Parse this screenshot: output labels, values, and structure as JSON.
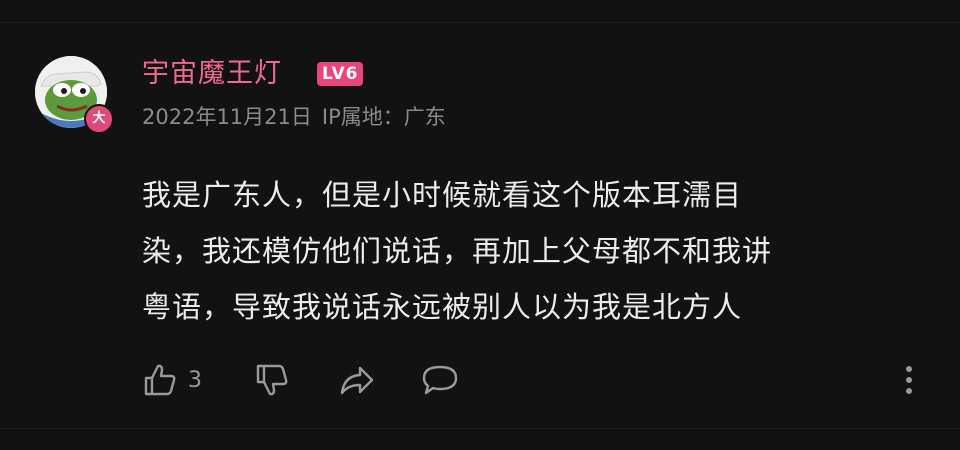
{
  "comment": {
    "username": "宇宙魔王灯",
    "level": "LV6",
    "avatar_badge": "大",
    "date": "2022年11月21日",
    "ip_location": "IP属地：广东",
    "text_lines": [
      "我是广东人，但是小时候就看这个版本耳濡目",
      "染，我还模仿他们说话，再加上父母都不和我讲",
      "粤语，导致我说话永远被别人以为我是北方人"
    ],
    "like_count": "3"
  },
  "icons": {
    "like": "thumbs-up-icon",
    "dislike": "thumbs-down-icon",
    "share": "share-icon",
    "reply": "reply-icon",
    "more": "more-vertical-icon"
  },
  "colors": {
    "background": "#121212",
    "username": "#ee6a91",
    "level_badge": "#e8457a",
    "meta_text": "#8b8b8b",
    "comment_text": "#ececec",
    "action_icons": "#9a9a9a"
  }
}
